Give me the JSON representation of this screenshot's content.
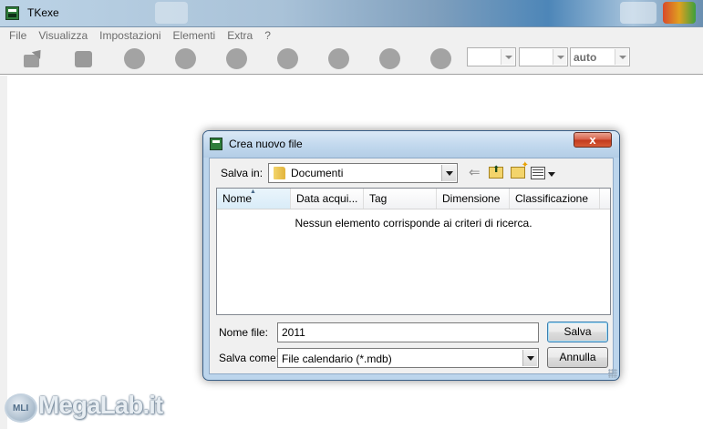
{
  "app": {
    "title": "TKexe"
  },
  "menu": [
    {
      "label": "File"
    },
    {
      "label": "Visualizza"
    },
    {
      "label": "Impostazioni"
    },
    {
      "label": "Elementi"
    },
    {
      "label": "Extra"
    },
    {
      "label": "?"
    }
  ],
  "toolbar": {
    "icons": [
      "open-icon",
      "square-icon",
      "circle-icon",
      "circle-icon",
      "circle-icon",
      "circle-icon",
      "circle-icon",
      "circle-icon",
      "circle-icon"
    ],
    "combos": [
      {
        "value": ""
      },
      {
        "value": ""
      },
      {
        "value": "auto"
      }
    ]
  },
  "dialog": {
    "title": "Crea nuovo file",
    "close_label": "x",
    "save_in_label": "Salva in:",
    "save_in_value": "Documenti",
    "columns": [
      {
        "label": "Nome"
      },
      {
        "label": "Data acqui..."
      },
      {
        "label": "Tag"
      },
      {
        "label": "Dimensione"
      },
      {
        "label": "Classificazione"
      }
    ],
    "empty_message": "Nessun elemento corrisponde ai criteri di ricerca.",
    "filename_label": "Nome file:",
    "filename_value": "2011",
    "filetype_label": "Salva come:",
    "filetype_value": "File calendario (*.mdb)",
    "save_button": "Salva",
    "cancel_button": "Annulla"
  },
  "watermark": {
    "badge": "MLI",
    "text": "MegaLab.it"
  },
  "colors": {
    "titlebar_accent": "#4d86b8",
    "dialog_frame": "#bcd5ec",
    "close_button": "#c23a1d",
    "disabled_text": "#6d6d6d"
  }
}
